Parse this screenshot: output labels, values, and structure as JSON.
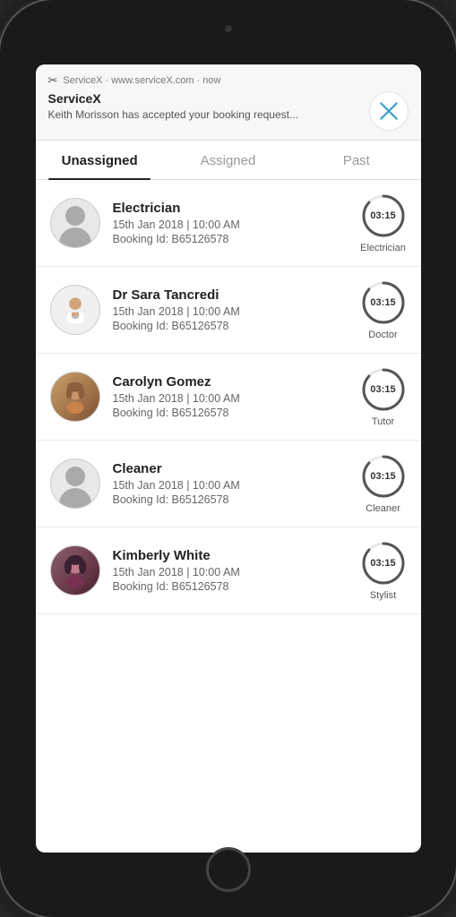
{
  "phone": {
    "notification": {
      "source": "ServiceX · www.serviceX.com · now",
      "icon": "✂",
      "title": "ServiceX",
      "body": "Keith Morisson  has accepted your booking request..."
    },
    "tabs": [
      {
        "label": "Unassigned",
        "active": true
      },
      {
        "label": "Assigned",
        "active": false
      },
      {
        "label": "Past",
        "active": false
      }
    ],
    "bookings": [
      {
        "id": "b1",
        "name": "Electrician",
        "date": "15th Jan 2018 | 10:00 AM",
        "bookingId": "Booking Id: B65126578",
        "timerValue": "03:15",
        "timerLabel": "Electrician",
        "avatarType": "electrician"
      },
      {
        "id": "b2",
        "name": "Dr Sara Tancredi",
        "date": "15th Jan 2018 | 10:00 AM",
        "bookingId": "Booking Id: B65126578",
        "timerValue": "03:15",
        "timerLabel": "Doctor",
        "avatarType": "doctor"
      },
      {
        "id": "b3",
        "name": "Carolyn Gomez",
        "date": "15th Jan 2018 | 10:00 AM",
        "bookingId": "Booking Id: B65126578",
        "timerValue": "03:15",
        "timerLabel": "Tutor",
        "avatarType": "carolyn"
      },
      {
        "id": "b4",
        "name": "Cleaner",
        "date": "15th Jan 2018 | 10:00 AM",
        "bookingId": "Booking Id: B65126578",
        "timerValue": "03:15",
        "timerLabel": "Cleaner",
        "avatarType": "cleaner"
      },
      {
        "id": "b5",
        "name": "Kimberly White",
        "date": "15th Jan 2018 | 10:00 AM",
        "bookingId": "Booking Id: B65126578",
        "timerValue": "03:15",
        "timerLabel": "Stylist",
        "avatarType": "kimberly"
      }
    ]
  }
}
